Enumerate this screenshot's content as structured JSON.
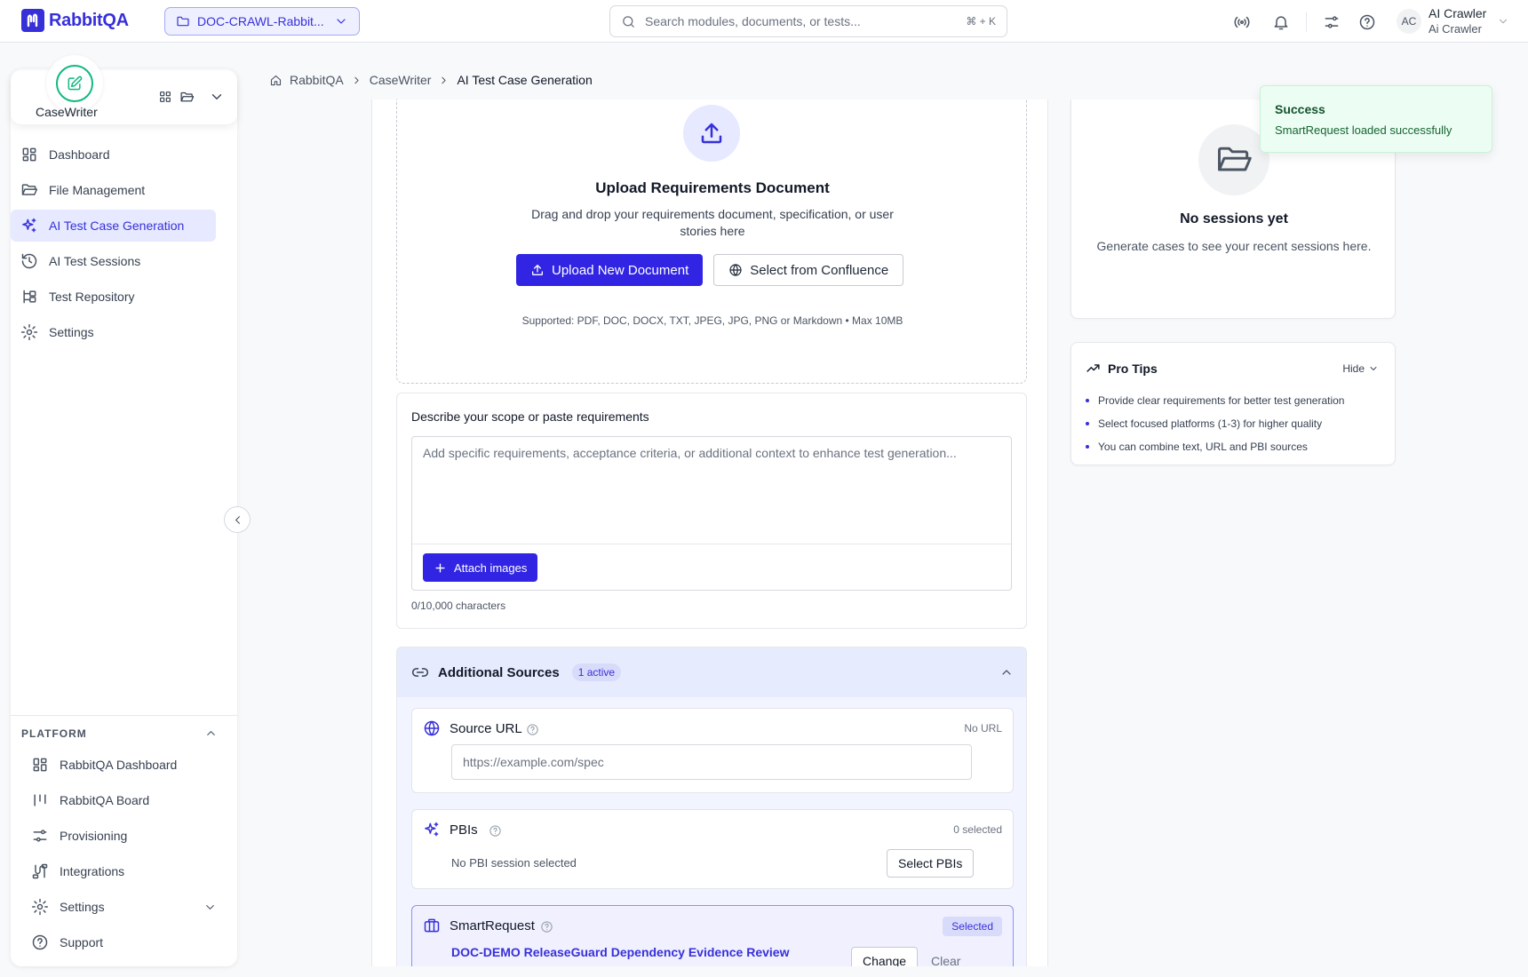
{
  "brand": {
    "name": "RabbitQA"
  },
  "topbar": {
    "project": "DOC-CRAWL-Rabbit...",
    "search_placeholder": "Search modules, documents, or tests...",
    "search_shortcut": "⌘ + K",
    "user": {
      "initials": "AC",
      "name": "AI Crawler",
      "subtitle": "Ai Crawler"
    }
  },
  "sidebar": {
    "app_name": "CaseWriter",
    "items": [
      {
        "label": "Dashboard",
        "icon": "dashboard-icon"
      },
      {
        "label": "File Management",
        "icon": "folder-icon"
      },
      {
        "label": "AI Test Case Generation",
        "icon": "sparkles-icon",
        "active": true
      },
      {
        "label": "AI Test Sessions",
        "icon": "history-icon"
      },
      {
        "label": "Test Repository",
        "icon": "tree-icon"
      },
      {
        "label": "Settings",
        "icon": "gear-icon"
      }
    ],
    "platform_title": "PLATFORM",
    "platform_items": [
      {
        "label": "RabbitQA Dashboard",
        "icon": "dashboard-icon"
      },
      {
        "label": "RabbitQA Board",
        "icon": "board-icon"
      },
      {
        "label": "Provisioning",
        "icon": "sliders-icon"
      },
      {
        "label": "Integrations",
        "icon": "integrations-icon"
      },
      {
        "label": "Settings",
        "icon": "gear-icon"
      },
      {
        "label": "Support",
        "icon": "help-icon"
      }
    ]
  },
  "breadcrumb": [
    "RabbitQA",
    "CaseWriter",
    "AI Test Case Generation"
  ],
  "upload": {
    "title": "Upload Requirements Document",
    "description": "Drag and drop your requirements document, specification, or user stories here",
    "upload_button": "Upload New Document",
    "confluence_button": "Select from Confluence",
    "supported": "Supported: PDF, DOC, DOCX, TXT, JPEG, JPG, PNG or Markdown • Max 10MB"
  },
  "scope": {
    "label": "Describe your scope or paste requirements",
    "placeholder": "Add specific requirements, acceptance criteria, or additional context to enhance test generation...",
    "attach_button": "Attach images",
    "char_count": "0/10,000 characters"
  },
  "sources": {
    "title": "Additional Sources",
    "active_badge": "1 active",
    "source_url": {
      "title": "Source URL",
      "status": "No URL",
      "placeholder": "https://example.com/spec"
    },
    "pbis": {
      "title": "PBIs",
      "status": "0 selected",
      "empty": "No PBI session selected",
      "button": "Select PBIs"
    },
    "smart_request": {
      "title": "SmartRequest",
      "status": "Selected",
      "name": "DOC-DEMO ReleaseGuard Dependency Evidence Review",
      "change": "Change",
      "clear": "Clear"
    }
  },
  "sessions": {
    "title": "No sessions yet",
    "subtitle": "Generate cases to see your recent sessions here."
  },
  "tips": {
    "title": "Pro Tips",
    "hide": "Hide",
    "items": [
      "Provide clear requirements for better test generation",
      "Select focused platforms (1-3) for higher quality",
      "You can combine text, URL and PBI sources"
    ]
  },
  "toast": {
    "title": "Success",
    "message": "SmartRequest loaded successfully"
  },
  "colors": {
    "accent": "#3125e3",
    "active_bg": "#e6e9ff",
    "app_badge": "#10b981",
    "toast_bg": "#ecfdf3"
  }
}
